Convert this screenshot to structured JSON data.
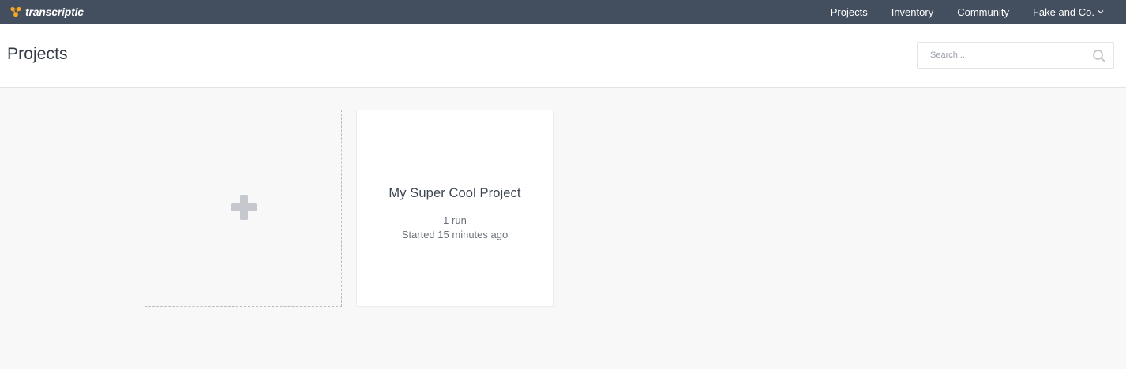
{
  "brand": {
    "name": "transcriptic",
    "logo_icon": "transcriptic-logo-icon",
    "logo_color": "#f5a623"
  },
  "nav": {
    "items": [
      {
        "label": "Projects"
      },
      {
        "label": "Inventory"
      },
      {
        "label": "Community"
      }
    ],
    "account": {
      "label": "Fake and Co.",
      "icon": "chevron-down-icon"
    }
  },
  "header": {
    "title": "Projects",
    "search": {
      "placeholder": "Search...",
      "value": "",
      "icon": "search-icon"
    }
  },
  "cards": {
    "new_project": {
      "icon": "plus-icon"
    },
    "projects": [
      {
        "name": "My Super Cool Project",
        "runs": "1 run",
        "started": "Started 15 minutes ago"
      }
    ]
  },
  "colors": {
    "navbar_bg": "#434e5e",
    "page_bg": "#f8f8f8",
    "card_bg": "#ffffff",
    "plus_icon": "#c5c8cd"
  }
}
